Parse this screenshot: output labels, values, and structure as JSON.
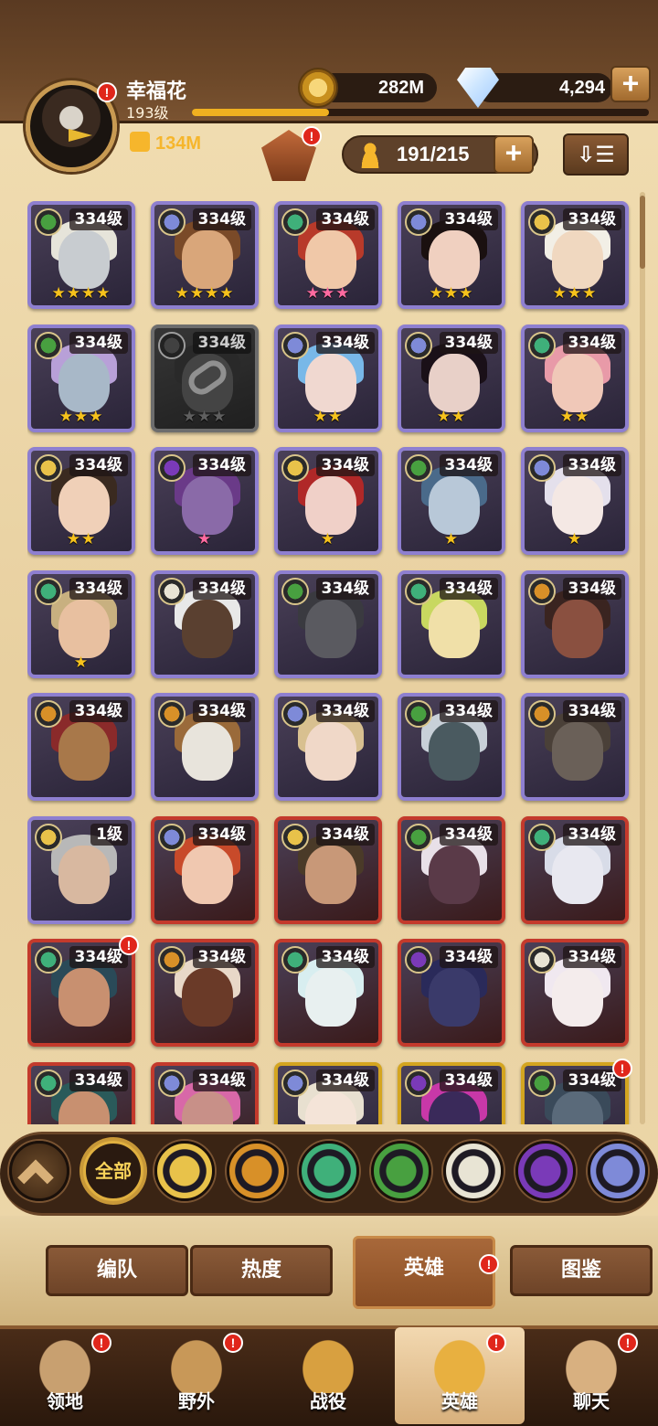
{
  "player": {
    "name": "幸福花",
    "level": "193级",
    "power": "134M",
    "xp_progress": 0.3
  },
  "currency": {
    "gold": "282M",
    "diamonds": "4,294"
  },
  "heroes": {
    "count": "191/215"
  },
  "faction_colors": {
    "lightbearer": "#e8c24a",
    "mauler": "#d89028",
    "wilder": "#3fb07a",
    "graveborn": "#48a040",
    "celestial": "#e8e4d4",
    "hypogean": "#7a3ab8",
    "dimensional": "#7e8ad8"
  },
  "hero_cards": [
    {
      "level": "334级",
      "faction": "graveborn",
      "border": "purple",
      "stars": "★★★★",
      "star_color": "gold",
      "skin": "#c8ccd0",
      "hair": "#e6e4da"
    },
    {
      "level": "334级",
      "faction": "dimensional",
      "border": "purple",
      "stars": "★★★★",
      "star_color": "gold",
      "skin": "#d9a67a",
      "hair": "#7a4a28"
    },
    {
      "level": "334级",
      "faction": "wilder",
      "border": "purple",
      "stars": "★★★",
      "star_color": "pink",
      "skin": "#f0c8a8",
      "hair": "#b83a2a"
    },
    {
      "level": "334级",
      "faction": "dimensional",
      "border": "purple",
      "stars": "★★★",
      "star_color": "gold",
      "skin": "#f0d0c0",
      "hair": "#1a1010"
    },
    {
      "level": "334级",
      "faction": "lightbearer",
      "border": "purple",
      "stars": "★★★",
      "star_color": "gold",
      "skin": "#f0d8c0",
      "hair": "#f2efe6"
    },
    {
      "level": "334级",
      "faction": "graveborn",
      "border": "purple",
      "stars": "★★★",
      "star_color": "gold",
      "skin": "#a8b8c8",
      "hair": "#b8a0d8"
    },
    {
      "level": "334级",
      "faction": "hypogean",
      "border": "locked",
      "stars": "★★★",
      "star_color": "gray",
      "skin": "#555555",
      "hair": "#333333"
    },
    {
      "level": "334级",
      "faction": "dimensional",
      "border": "purple",
      "stars": "★★",
      "star_color": "gold",
      "skin": "#f0d8d0",
      "hair": "#78b8e8"
    },
    {
      "level": "334级",
      "faction": "dimensional",
      "border": "purple",
      "stars": "★★",
      "star_color": "gold",
      "skin": "#e8d0c8",
      "hair": "#1a1018"
    },
    {
      "level": "334级",
      "faction": "wilder",
      "border": "purple",
      "stars": "★★",
      "star_color": "gold",
      "skin": "#f0c8b8",
      "hair": "#e89aa8"
    },
    {
      "level": "334级",
      "faction": "lightbearer",
      "border": "purple",
      "stars": "★★",
      "star_color": "gold",
      "skin": "#f0d0b8",
      "hair": "#3a2a20"
    },
    {
      "level": "334级",
      "faction": "hypogean",
      "border": "purple",
      "stars": "★",
      "star_color": "pink",
      "skin": "#8a6aa8",
      "hair": "#6a3a88"
    },
    {
      "level": "334级",
      "faction": "lightbearer",
      "border": "purple",
      "stars": "★",
      "star_color": "gold",
      "skin": "#f0d0c8",
      "hair": "#b02828"
    },
    {
      "level": "334级",
      "faction": "graveborn",
      "border": "purple",
      "stars": "★",
      "star_color": "gold",
      "skin": "#b8c8d8",
      "hair": "#4a6a8a"
    },
    {
      "level": "334级",
      "faction": "dimensional",
      "border": "purple",
      "stars": "★",
      "star_color": "gold",
      "skin": "#f4e8e4",
      "hair": "#e4e0ec"
    },
    {
      "level": "334级",
      "faction": "wilder",
      "border": "purple",
      "stars": "★",
      "star_color": "gold",
      "skin": "#e8c0a0",
      "hair": "#c8b080"
    },
    {
      "level": "334级",
      "faction": "celestial",
      "border": "purple",
      "stars": "",
      "star_color": "gold",
      "skin": "#5a4030",
      "hair": "#e8e8e8"
    },
    {
      "level": "334级",
      "faction": "graveborn",
      "border": "purple",
      "stars": "",
      "star_color": "gold",
      "skin": "#5a5a60",
      "hair": "#3a3a40"
    },
    {
      "level": "334级",
      "faction": "wilder",
      "border": "purple",
      "stars": "",
      "star_color": "gold",
      "skin": "#f0e0a8",
      "hair": "#c8d860"
    },
    {
      "level": "334级",
      "faction": "mauler",
      "border": "purple",
      "stars": "",
      "star_color": "gold",
      "skin": "#8a5040",
      "hair": "#3a2420"
    },
    {
      "level": "334级",
      "faction": "mauler",
      "border": "purple",
      "stars": "",
      "star_color": "gold",
      "skin": "#a8784a",
      "hair": "#8a2a2a"
    },
    {
      "level": "334级",
      "faction": "mauler",
      "border": "purple",
      "stars": "",
      "star_color": "gold",
      "skin": "#e8e4dc",
      "hair": "#9a6a3a"
    },
    {
      "level": "334级",
      "faction": "dimensional",
      "border": "purple",
      "stars": "",
      "star_color": "gold",
      "skin": "#f0d8c8",
      "hair": "#d8c090"
    },
    {
      "level": "334级",
      "faction": "graveborn",
      "border": "purple",
      "stars": "",
      "star_color": "gold",
      "skin": "#4a5a60",
      "hair": "#c8d0d8"
    },
    {
      "level": "334级",
      "faction": "mauler",
      "border": "purple",
      "stars": "",
      "star_color": "gold",
      "skin": "#6a6058",
      "hair": "#4a4038"
    },
    {
      "level": "1级",
      "faction": "lightbearer",
      "border": "purple",
      "stars": "",
      "star_color": "gold",
      "skin": "#d8b8a0",
      "hair": "#b8b8b8"
    },
    {
      "level": "334级",
      "faction": "dimensional",
      "border": "red",
      "stars": "",
      "star_color": "gold",
      "skin": "#f0c8b0",
      "hair": "#c84a2a"
    },
    {
      "level": "334级",
      "faction": "lightbearer",
      "border": "red",
      "stars": "",
      "star_color": "gold",
      "skin": "#c89878",
      "hair": "#4a3a28"
    },
    {
      "level": "334级",
      "faction": "graveborn",
      "border": "red",
      "stars": "",
      "star_color": "gold",
      "skin": "#5a3a48",
      "hair": "#e8e0e8"
    },
    {
      "level": "334级",
      "faction": "wilder",
      "border": "red",
      "stars": "",
      "star_color": "gold",
      "skin": "#e8e8f0",
      "hair": "#d8dce8"
    },
    {
      "level": "334级",
      "faction": "wilder",
      "border": "red",
      "stars": "",
      "star_color": "gold",
      "skin": "#c89070",
      "hair": "#2a4a58"
    },
    {
      "level": "334级",
      "faction": "mauler",
      "border": "red",
      "stars": "",
      "star_color": "gold",
      "skin": "#6a3a28",
      "hair": "#e8d8c8"
    },
    {
      "level": "334级",
      "faction": "wilder",
      "border": "red",
      "stars": "",
      "star_color": "gold",
      "skin": "#e8f0f0",
      "hair": "#d8eef0"
    },
    {
      "level": "334级",
      "faction": "hypogean",
      "border": "red",
      "stars": "",
      "star_color": "gold",
      "skin": "#3a3a6a",
      "hair": "#2a2a5a"
    },
    {
      "level": "334级",
      "faction": "celestial",
      "border": "red",
      "stars": "",
      "star_color": "gold",
      "skin": "#f4ecec",
      "hair": "#f0e8f0"
    },
    {
      "level": "334级",
      "faction": "wilder",
      "border": "red",
      "stars": "",
      "star_color": "gold",
      "skin": "#c89070",
      "hair": "#2a5a5a"
    },
    {
      "level": "334级",
      "faction": "dimensional",
      "border": "red",
      "stars": "",
      "star_color": "gold",
      "skin": "#c89088",
      "hair": "#d868a8"
    },
    {
      "level": "334级",
      "faction": "dimensional",
      "border": "gold",
      "stars": "",
      "star_color": "gold",
      "skin": "#f4e4d8",
      "hair": "#e8e0d0"
    },
    {
      "level": "334级",
      "faction": "hypogean",
      "border": "gold",
      "stars": "",
      "star_color": "gold",
      "skin": "#3a2a5a",
      "hair": "#c838a8"
    },
    {
      "level": "334级",
      "faction": "graveborn",
      "border": "gold",
      "stars": "",
      "star_color": "gold",
      "skin": "#5a6a7a",
      "hair": "#3a4a5a"
    }
  ],
  "filters": {
    "all_label": "全部",
    "factions": [
      "lightbearer",
      "mauler",
      "wilder",
      "graveborn",
      "celestial",
      "hypogean",
      "dimensional"
    ]
  },
  "subtabs": [
    {
      "label": "编队",
      "active": false
    },
    {
      "label": "热度",
      "active": false
    },
    {
      "label": "英雄",
      "active": true
    },
    {
      "label": "图鉴",
      "active": false
    }
  ],
  "nav": [
    {
      "label": "领地",
      "active": false
    },
    {
      "label": "野外",
      "active": false
    },
    {
      "label": "战役",
      "active": false
    },
    {
      "label": "英雄",
      "active": true
    },
    {
      "label": "聊天",
      "active": false
    }
  ]
}
